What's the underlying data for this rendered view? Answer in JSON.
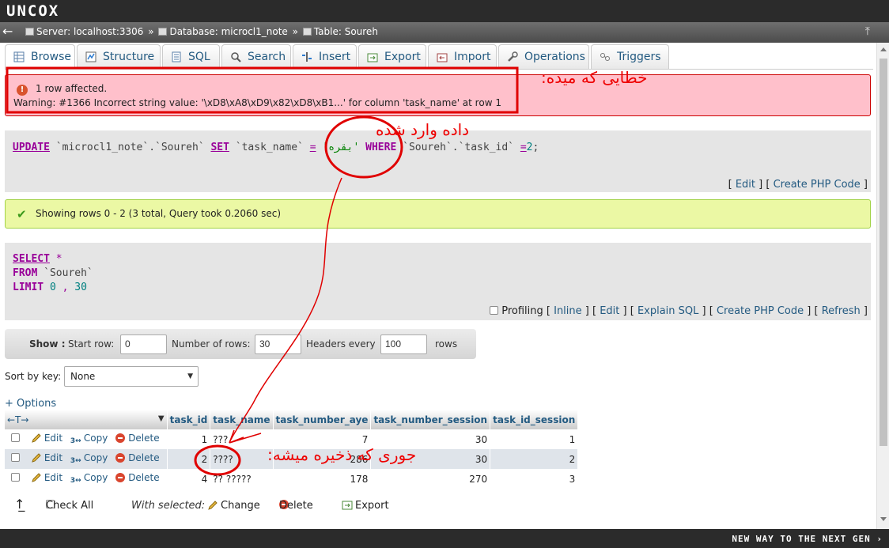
{
  "branding": {
    "logo": "UNCOX",
    "tagline": "NEW WAY TO THE NEXT GEN ›"
  },
  "breadcrumb": {
    "server": "Server: localhost:3306",
    "database": "Database: microcl1_note",
    "table": "Table: Soureh",
    "sep": "»"
  },
  "tabs": [
    {
      "label": "Browse",
      "icon": "table-icon"
    },
    {
      "label": "Structure",
      "icon": "structure-icon"
    },
    {
      "label": "SQL",
      "icon": "sql-icon"
    },
    {
      "label": "Search",
      "icon": "search-icon"
    },
    {
      "label": "Insert",
      "icon": "insert-icon"
    },
    {
      "label": "Export",
      "icon": "export-icon"
    },
    {
      "label": "Import",
      "icon": "import-icon"
    },
    {
      "label": "Operations",
      "icon": "wrench-icon"
    },
    {
      "label": "Triggers",
      "icon": "triggers-icon"
    }
  ],
  "error": {
    "line1": "1 row affected.",
    "line2": "Warning: #1366 Incorrect string value: '\\xD8\\xA8\\xD9\\x82\\xD8\\xB1...' for column 'task_name' at row 1"
  },
  "update_sql": {
    "kw_update": "UPDATE",
    "target": "`microcl1_note`.`Soureh`",
    "kw_set": "SET",
    "col": "`task_name`",
    "eq": "=",
    "value": "'بقره'",
    "kw_where": "WHERE",
    "where_col": "`Soureh`.`task_id`",
    "eq2": "=",
    "where_val": "2",
    "semicolon": ";"
  },
  "update_links": {
    "edit": "Edit",
    "create_php": "Create PHP Code"
  },
  "success": {
    "text": "Showing rows 0 - 2 (3 total, Query took 0.2060 sec)"
  },
  "select_sql": {
    "kw_select": "SELECT",
    "star": "*",
    "kw_from": "FROM",
    "table": "`Soureh`",
    "kw_limit": "LIMIT",
    "offset": "0",
    "comma": ",",
    "count": "30"
  },
  "profiling": {
    "label": "Profiling",
    "inline": "Inline",
    "edit": "Edit",
    "explain": "Explain SQL",
    "create_php": "Create PHP Code",
    "refresh": "Refresh"
  },
  "nav": {
    "show": "Show :",
    "start_row_label": "Start row:",
    "start_row": "0",
    "num_rows_label": "Number of rows:",
    "num_rows": "30",
    "headers_label": "Headers every",
    "headers_every": "100",
    "rows": "rows"
  },
  "sort": {
    "label": "Sort by key:",
    "value": "None"
  },
  "options_link": "+ Options",
  "table": {
    "nav_arrows": "←T→",
    "sort_arrow": "▼",
    "columns": [
      "task_id",
      "task_name",
      "task_number_aye",
      "task_number_session",
      "task_id_session"
    ],
    "rows": [
      {
        "task_id": "1",
        "task_name": "???",
        "task_number_aye": "7",
        "task_number_session": "30",
        "task_id_session": "1"
      },
      {
        "task_id": "2",
        "task_name": "????",
        "task_number_aye": "286",
        "task_number_session": "30",
        "task_id_session": "2"
      },
      {
        "task_id": "4",
        "task_name": "?? ?????",
        "task_number_aye": "178",
        "task_number_session": "270",
        "task_id_session": "3"
      }
    ],
    "edit": "Edit",
    "copy": "Copy",
    "delete": "Delete"
  },
  "footer": {
    "check_all": "Check All",
    "with_selected": "With selected:",
    "change": "Change",
    "delete": "Delete",
    "export": "Export"
  },
  "annotations": {
    "error_note": "خطایی که میده:",
    "data_note": "داده وارد شده",
    "saved_note": "جوری که ذخیره میشه:",
    "color": "#e00000"
  }
}
